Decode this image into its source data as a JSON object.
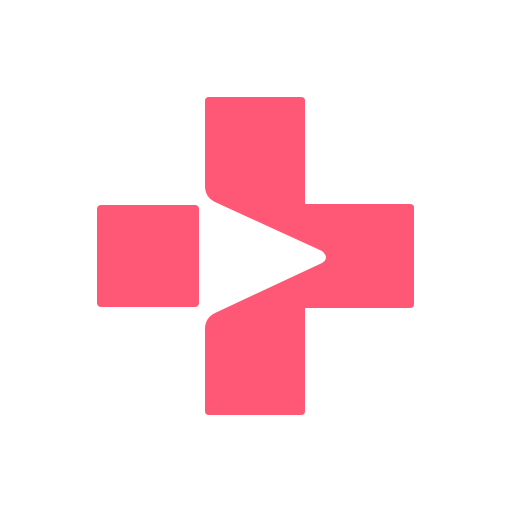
{
  "logo": {
    "name": "medical-play-cross-logo",
    "primary_color": "#FF5876",
    "background_color": "#FFFFFF"
  }
}
